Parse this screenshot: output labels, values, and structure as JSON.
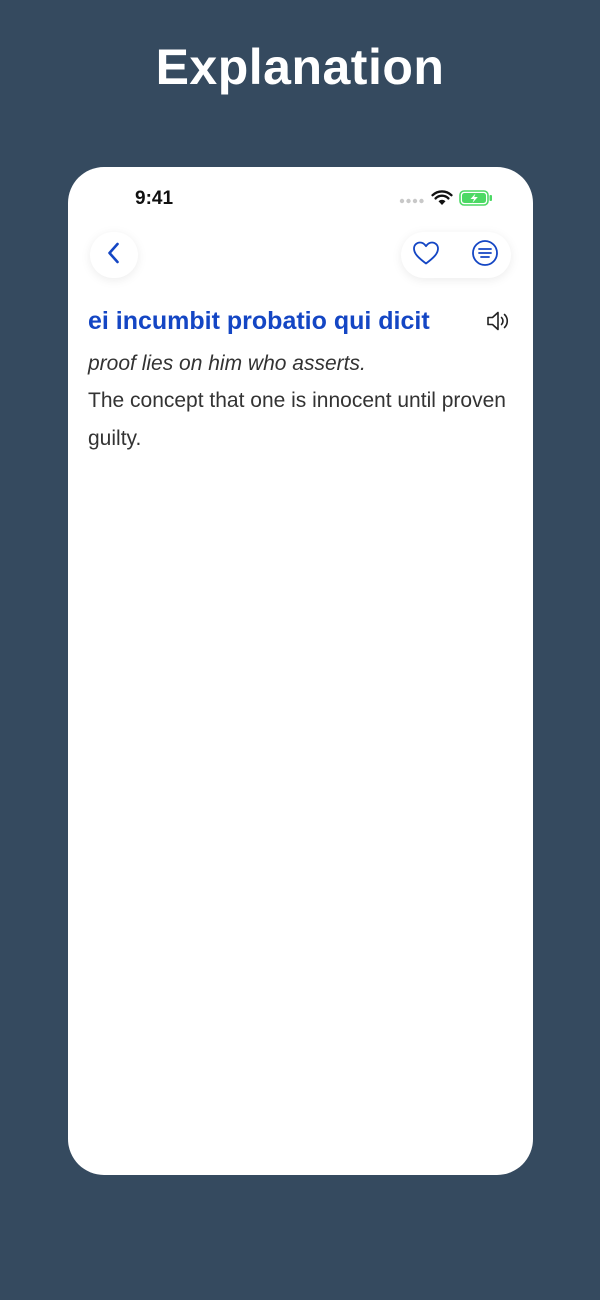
{
  "promo": {
    "title": "Explanation"
  },
  "status_bar": {
    "time": "9:41",
    "icons": [
      "signal-dots-icon",
      "wifi-icon",
      "battery-charging-icon"
    ]
  },
  "nav": {
    "back_icon": "chevron-left-icon",
    "favorite_icon": "heart-icon",
    "menu_icon": "list-circle-icon"
  },
  "entry": {
    "term": "ei incumbit probatio qui dicit",
    "translation": "proof lies on him who asserts.",
    "explanation": "The concept that one is innocent until proven guilty.",
    "speaker_icon": "speaker-icon"
  },
  "colors": {
    "background": "#354a5f",
    "accent": "#1446c4",
    "battery": "#4cd964"
  }
}
